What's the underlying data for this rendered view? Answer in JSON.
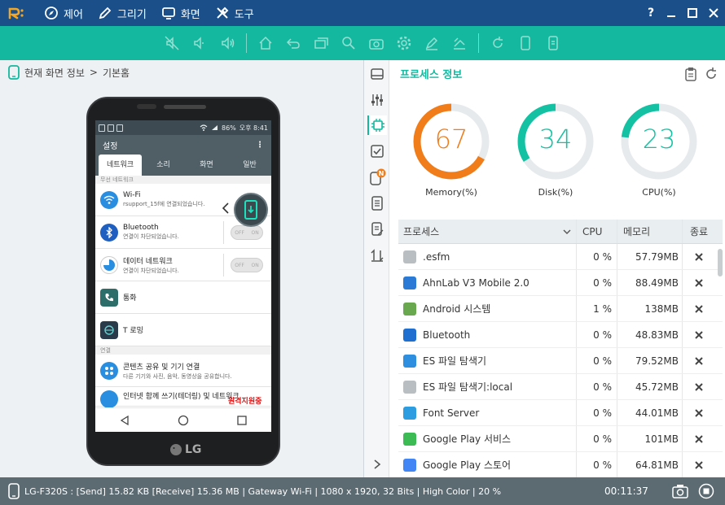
{
  "menu": {
    "items": [
      {
        "label": "제어",
        "icon": "compass-icon"
      },
      {
        "label": "그리기",
        "icon": "pen-icon"
      },
      {
        "label": "화면",
        "icon": "monitor-icon"
      },
      {
        "label": "도구",
        "icon": "tools-icon"
      }
    ],
    "help": "?"
  },
  "breadcrumb": {
    "part1": "현재 화면 정보",
    "sep": ">",
    "part2": "기본홈"
  },
  "phone": {
    "brand": "LG",
    "status": {
      "battery": "86%",
      "time": "오후 8:41"
    },
    "app_title": "설정",
    "tabs": [
      "네트워크",
      "소리",
      "화면",
      "일반"
    ],
    "section1": "무선 네트워크",
    "section2": "연결",
    "rows": [
      {
        "title": "Wi-Fi",
        "sub": "rsupport_15f에 연결되었습니다."
      },
      {
        "title": "Bluetooth",
        "sub": "연결이 차단되었습니다.",
        "toggle_off": "OFF",
        "toggle_on": "ON"
      },
      {
        "title": "데이터 네트워크",
        "sub": "연결이 차단되었습니다.",
        "toggle_off": "OFF",
        "toggle_on": "ON"
      },
      {
        "title": "통화",
        "sub": ""
      },
      {
        "title": "T 로밍",
        "sub": ""
      },
      {
        "title": "콘텐츠 공유 및 기기 연결",
        "sub": "다른 기기와 사진, 음악, 동영상을 공유합니다."
      },
      {
        "title": "인터넷 함께 쓰기(테더링) 및 네트워크",
        "sub": ""
      }
    ],
    "watermark": "원격지원중"
  },
  "process_panel": {
    "title": "프로세스 정보",
    "gauges": [
      {
        "label": "Memory(%)",
        "value": 67,
        "color": "#f07d1a"
      },
      {
        "label": "Disk(%)",
        "value": 34,
        "color": "#14c2a3"
      },
      {
        "label": "CPU(%)",
        "value": 23,
        "color": "#14c2a3"
      }
    ],
    "headers": {
      "name": "프로세스",
      "cpu": "CPU",
      "mem": "메모리",
      "end": "종료"
    },
    "rows": [
      {
        "name": ".esfm",
        "cpu": "0 %",
        "mem": "57.79MB",
        "icon": "generic-app-icon",
        "color": "#b8bec2"
      },
      {
        "name": "AhnLab V3 Mobile 2.0",
        "cpu": "0 %",
        "mem": "88.49MB",
        "icon": "ahnlab-icon",
        "color": "#2b7bd6"
      },
      {
        "name": "Android 시스템",
        "cpu": "1 %",
        "mem": "138MB",
        "icon": "android-system-icon",
        "color": "#6aa84f"
      },
      {
        "name": "Bluetooth",
        "cpu": "0 %",
        "mem": "48.83MB",
        "icon": "bluetooth-icon",
        "color": "#1f6fd1"
      },
      {
        "name": "ES 파일 탐색기",
        "cpu": "0 %",
        "mem": "79.52MB",
        "icon": "es-file-icon",
        "color": "#2e8fe0"
      },
      {
        "name": "ES 파일 탐색기:local",
        "cpu": "0 %",
        "mem": "45.72MB",
        "icon": "generic-app-icon",
        "color": "#b8bec2"
      },
      {
        "name": "Font Server",
        "cpu": "0 %",
        "mem": "44.01MB",
        "icon": "font-server-icon",
        "color": "#2c9de0"
      },
      {
        "name": "Google  Play 서비스",
        "cpu": "0 %",
        "mem": "101MB",
        "icon": "play-services-icon",
        "color": "#3cba54"
      },
      {
        "name": "Google  Play 스토어",
        "cpu": "0 %",
        "mem": "64.81MB",
        "icon": "play-store-icon",
        "color": "#4285f4"
      }
    ]
  },
  "statusbar": {
    "info": "LG-F320S : [Send] 15.82 KB  [Receive] 15.36 MB | Gateway Wi-Fi | 1080 x 1920, 32 Bits | High Color | 20 %",
    "time": "00:11:37"
  },
  "colors": {
    "titlebar": "#1a4f8a",
    "toolbar": "#14b89f",
    "accent": "#14b89f",
    "memory": "#f07d1a"
  }
}
